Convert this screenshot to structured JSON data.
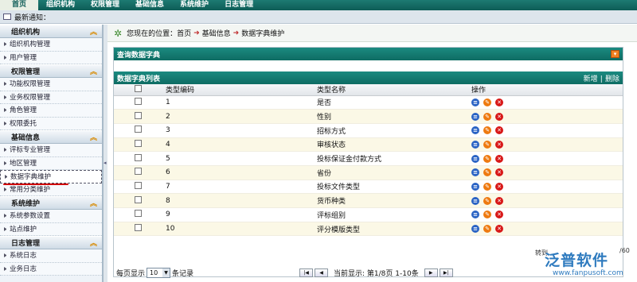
{
  "topnav": [
    "首页",
    "组织机构",
    "权限管理",
    "基础信息",
    "系统维护",
    "日志管理"
  ],
  "notice": {
    "label": "最新通知："
  },
  "sidebar": {
    "groups": [
      {
        "title": "组织机构",
        "items": [
          "组织机构管理",
          "用户管理"
        ]
      },
      {
        "title": "权限管理",
        "items": [
          "功能权限管理",
          "业务权限管理",
          "角色管理",
          "权限委托"
        ]
      },
      {
        "title": "基础信息",
        "items": [
          "评标专业管理",
          "地区管理",
          "数据字典维护",
          "常用分类维护"
        ]
      },
      {
        "title": "系统维护",
        "items": [
          "系统参数设置",
          "站点维护"
        ]
      },
      {
        "title": "日志管理",
        "items": [
          "系统日志",
          "业务日志"
        ]
      }
    ]
  },
  "breadcrumb": {
    "prefix": "您现在的位置：",
    "path": [
      "首页",
      "基础信息",
      "数据字典维护"
    ]
  },
  "query": {
    "title": "查询数据字典"
  },
  "list": {
    "title": "数据字典列表",
    "add": "新增",
    "sep": "|",
    "remove": "删除",
    "columns": [
      "类型编码",
      "类型名称",
      "操作"
    ],
    "rows": [
      {
        "code": "1",
        "name": "是否"
      },
      {
        "code": "2",
        "name": "性别"
      },
      {
        "code": "3",
        "name": "招标方式"
      },
      {
        "code": "4",
        "name": "审核状态"
      },
      {
        "code": "5",
        "name": "投标保证金付款方式"
      },
      {
        "code": "6",
        "name": "省份"
      },
      {
        "code": "7",
        "name": "投标文件类型"
      },
      {
        "code": "8",
        "name": "货币种类"
      },
      {
        "code": "9",
        "name": "评标组别"
      },
      {
        "code": "10",
        "name": "评分模版类型"
      }
    ]
  },
  "pager": {
    "per_page_label": "每页显示",
    "per_page": "10",
    "per_page_suffix": "条记录",
    "current_label": "当前显示: 第1/8页 1-10条",
    "goto_label": "转到",
    "pages_suffix": "/60"
  },
  "watermark": {
    "brand": "泛普软件",
    "url": "www.fanpusoft.com"
  }
}
